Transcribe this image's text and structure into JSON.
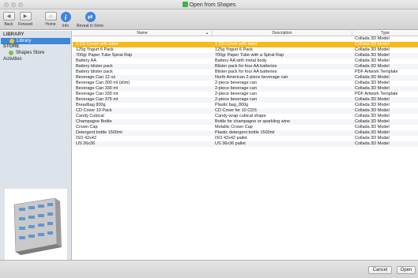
{
  "window": {
    "title": "Open from Shapes"
  },
  "toolbar": {
    "back": "Back",
    "forward": "Forward",
    "home": "Home",
    "info": "Info",
    "reveal": "Reveal in Store"
  },
  "sidebar": {
    "library_header": "LIBRARY",
    "library_item": "Library",
    "store_header": "STORE",
    "shapes_store": "Shapes Store",
    "activities": "Activities"
  },
  "table": {
    "columns": [
      "Name",
      "Description",
      "Type"
    ],
    "rows": [
      [
        "",
        "",
        "Collada 3D Model"
      ],
      [
        "1 CD Cover with label",
        "1 CD Cover with label",
        "Collada 3D Model"
      ],
      [
        "125g Yogurt 6 Pack",
        "125g Yogurt 6 Pack",
        "Collada 3D Model"
      ],
      [
        "700gr Paper Tube Spiral Rap",
        "700gr Paper Tube with a Spiral Rap",
        "Collada 3D Model"
      ],
      [
        "Battery AA",
        "Battery AA with metal body",
        "Collada 3D Model"
      ],
      [
        "Battery blister pack",
        "Blister pack for four AA batteries",
        "Collada 3D Model"
      ],
      [
        "Battery blister pack",
        "Blister pack for four AA batteries",
        "PDF Artwork Template"
      ],
      [
        "Beverage Can 12 oz",
        "North American 2-piece beverage can",
        "Collada 3D Model"
      ],
      [
        "Beverage Can 300 ml (slim)",
        "2-piece beverage can",
        "Collada 3D Model"
      ],
      [
        "Beverage Can 330 ml",
        "2-piece beverage can",
        "Collada 3D Model"
      ],
      [
        "Beverage Can 330 ml",
        "2-piece beverage can",
        "PDF Artwork Template"
      ],
      [
        "Beverage Can 375 ml",
        "2-piece beverage can",
        "Collada 3D Model"
      ],
      [
        "Breadbag 800g",
        "Plastic bag_800g",
        "Collada 3D Model"
      ],
      [
        "CD Cover 10 Pack",
        "CD Cover for 10 CDS",
        "Collada 3D Model"
      ],
      [
        "Candy Cubical",
        "Candy wrap cubical shape",
        "Collada 3D Model"
      ],
      [
        "Champagne Bottle",
        "Bottle for champagne or sparkling wine",
        "Collada 3D Model"
      ],
      [
        "Crown Cap",
        "Metallic Crown Cap",
        "Collada 3D Model"
      ],
      [
        "Detergent bottle 1500ml",
        "Plastic detergent bottle 1500ml",
        "Collada 3D Model"
      ],
      [
        "ISO 42x42",
        "ISO 42x42 pallet",
        "Collada 3D Model"
      ],
      [
        "US 36x36",
        "US 36x36 pallet",
        "Collada 3D Model"
      ]
    ],
    "selected_index": 1
  },
  "buttons": {
    "cancel": "Cancel",
    "open": "Open"
  },
  "colors": {
    "selection": "#f9b91a",
    "sidebar_selection": "#3d87d8",
    "accent": "#3f86d9"
  }
}
